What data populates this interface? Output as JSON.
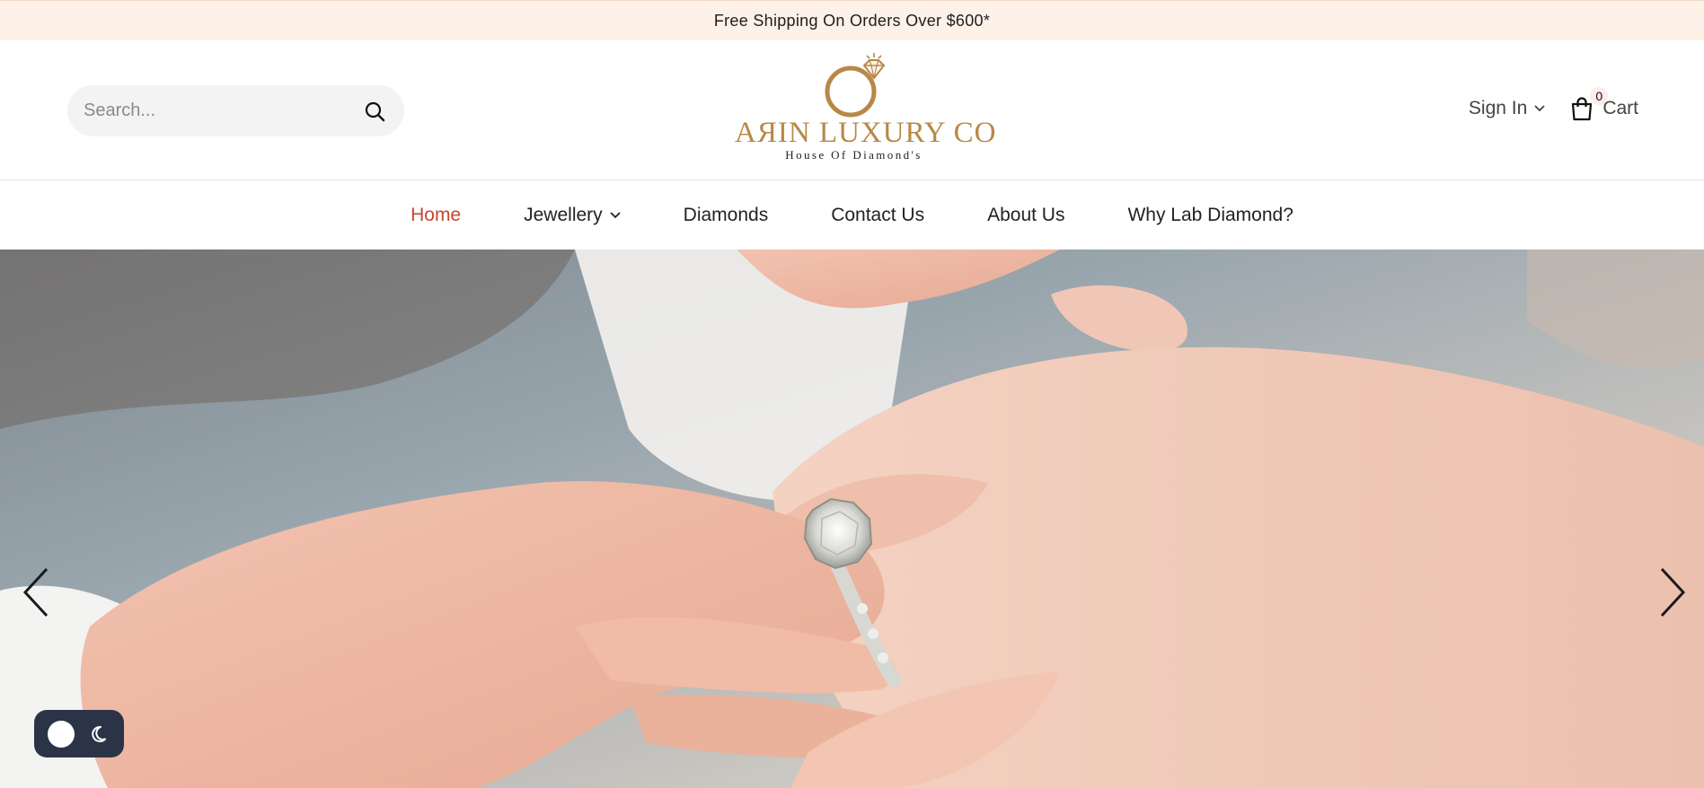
{
  "announcement": {
    "text": "Free Shipping On Orders Over $600*"
  },
  "search": {
    "placeholder": "Search...",
    "icon": "search-icon"
  },
  "logo": {
    "brand": "AЯIN LUXURY CO",
    "tagline": "House Of Diamond's",
    "icon": "diamond-ring-logo"
  },
  "account": {
    "sign_in_label": "Sign In",
    "cart_label": "Cart",
    "cart_count": "0"
  },
  "nav": {
    "items": [
      {
        "label": "Home",
        "active": true
      },
      {
        "label": "Jewellery",
        "has_dropdown": true
      },
      {
        "label": "Diamonds"
      },
      {
        "label": "Contact Us"
      },
      {
        "label": "About Us"
      },
      {
        "label": "Why Lab Diamond?"
      }
    ]
  },
  "colors": {
    "announcement_bg": "#fdf1e8",
    "brand_gold": "#b78847",
    "nav_active": "#c8462c",
    "toggle_bg": "#2b3347"
  },
  "hero": {
    "image": "hand-placing-diamond-engagement-ring"
  },
  "theme_toggle": {
    "icon_light": "sun-knob-icon",
    "icon_dark": "moon-icon"
  }
}
